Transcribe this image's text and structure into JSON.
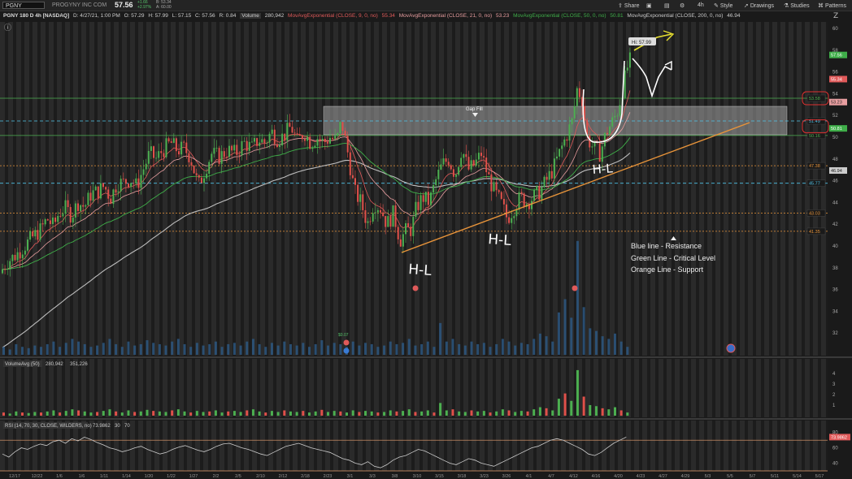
{
  "toolbar": {
    "symbol": "PGNY",
    "company": "PROGYNY INC COM",
    "price": "57.56",
    "change": "+1.66",
    "change_pct": "+2.97%",
    "bid": "B: 53.34",
    "ask": "A: 60.00",
    "buttons": {
      "share": "Share",
      "timeframe": "4h",
      "style": "Style",
      "drawings": "Drawings",
      "studies": "Studies",
      "patterns": "Patterns"
    }
  },
  "info": {
    "title": "PGNY 180 D 4h [NASDAQ]",
    "date": "D: 4/27/21, 1:00 PM",
    "open": "O: 57.29",
    "high": "H: 57.99",
    "low": "L: 57.15",
    "close": "C: 57.56",
    "rval": "R: 0.84",
    "volume_label": "Volume",
    "volume_val": "280,942",
    "ma9": "MovAvgExponential (CLOSE, 9, 0, no)",
    "ma9_val": "55.34",
    "ma21": "MovAvgExponential (CLOSE, 21, 0, no)",
    "ma21_val": "53.23",
    "ma50": "MovAvgExponential (CLOSE, 50, 0, no)",
    "ma50_val": "50.81",
    "ma200": "MovAvgExponential (CLOSE, 200, 0, no)",
    "ma200_val": "46.94"
  },
  "colors": {
    "up": "#4caf50",
    "down": "#e0504a",
    "ma9": "#e05a5a",
    "ma21": "#e89ea0",
    "ma50": "#3fae49",
    "ma200": "#bdbdbd",
    "resistance": "#4fc3e8",
    "critical": "#4caf50",
    "support": "#e8943a",
    "background": "#1a1a1a"
  },
  "annotations": {
    "gap_fill": "Gap Fill",
    "hi_label": "Hi: 57.99",
    "hl1": "H-L",
    "hl2": "H-L",
    "hl3": "H-L",
    "legend": [
      "Blue line - Resistance",
      "Green Line - Critical Level",
      "Orange Line - Support"
    ],
    "marker_label": "$0.07"
  },
  "price_tags": {
    "last": "57.56",
    "ma9": "55.34",
    "ma21": "53.23",
    "green_top": "53.58",
    "blue": "51.49",
    "green_mid": "50.16",
    "ma50": "50.81",
    "orange_top": "47.38",
    "ma200": "46.94",
    "blue_low": "45.77",
    "orange_mid": "43.03",
    "orange_low": "41.35"
  },
  "volume_panel": {
    "label": "VolumeAvg (50)",
    "val1": "280,942",
    "val2": "351,226",
    "ticks": [
      "4",
      "3",
      "2",
      "1"
    ]
  },
  "rsi_panel": {
    "label": "RSI (14, 70, 30, CLOSE, WILDERS, no)",
    "val": "73.9862",
    "ob": "30",
    "os": "70",
    "tag": "73.9862",
    "ticks": [
      "80",
      "60",
      "40"
    ]
  },
  "chart_data": {
    "type": "candlestick",
    "title": "PGNY 180 D 4h [NASDAQ]",
    "ylim": [
      30,
      60
    ],
    "yticks": [
      32,
      34,
      36,
      38,
      40,
      42,
      44,
      46,
      48,
      50,
      52,
      54,
      56,
      58,
      60
    ],
    "xticks": [
      "12/17",
      "12/22",
      "1/6",
      "1/6",
      "1/11",
      "1/14",
      "1/20",
      "1/22",
      "1/27",
      "2/2",
      "2/5",
      "2/10",
      "2/12",
      "2/18",
      "2/23",
      "3/1",
      "3/3",
      "3/8",
      "3/10",
      "3/15",
      "3/18",
      "3/23",
      "3/26",
      "4/1",
      "4/7",
      "4/12",
      "4/16",
      "4/20",
      "4/23",
      "4/27",
      "4/29",
      "5/3",
      "5/5",
      "5/7",
      "5/11",
      "5/14",
      "5/17"
    ],
    "price_path": [
      [
        0,
        37.5
      ],
      [
        8,
        38.5
      ],
      [
        20,
        39.2
      ],
      [
        30,
        40.0
      ],
      [
        40,
        40.8
      ],
      [
        50,
        41.5
      ],
      [
        58,
        42.5
      ],
      [
        66,
        41.8
      ],
      [
        72,
        43.0
      ],
      [
        80,
        43.5
      ],
      [
        88,
        42.8
      ],
      [
        96,
        44.0
      ],
      [
        104,
        43.6
      ],
      [
        112,
        44.8
      ],
      [
        120,
        45.0
      ],
      [
        128,
        45.5
      ],
      [
        136,
        44.4
      ],
      [
        144,
        45.8
      ],
      [
        152,
        45.8
      ],
      [
        160,
        46.2
      ],
      [
        168,
        45.5
      ],
      [
        176,
        47.0
      ],
      [
        184,
        48.5
      ],
      [
        192,
        48.0
      ],
      [
        200,
        48.8
      ],
      [
        210,
        49.5
      ],
      [
        218,
        48.8
      ],
      [
        226,
        49.0
      ],
      [
        234,
        48.2
      ],
      [
        244,
        45.5
      ],
      [
        252,
        47.0
      ],
      [
        260,
        48.5
      ],
      [
        270,
        48.2
      ],
      [
        280,
        48.8
      ],
      [
        290,
        48.5
      ],
      [
        300,
        49.5
      ],
      [
        310,
        49.0
      ],
      [
        318,
        49.8
      ],
      [
        326,
        49.5
      ],
      [
        334,
        50.5
      ],
      [
        342,
        49.8
      ],
      [
        350,
        50.2
      ],
      [
        358,
        51.0
      ],
      [
        366,
        49.5
      ],
      [
        374,
        50.5
      ],
      [
        382,
        49.5
      ],
      [
        390,
        50.0
      ],
      [
        398,
        49.5
      ],
      [
        406,
        50.0
      ],
      [
        414,
        49.6
      ],
      [
        420,
        51.5
      ],
      [
        428,
        48.5
      ],
      [
        436,
        45.0
      ],
      [
        444,
        44.0
      ],
      [
        452,
        42.0
      ],
      [
        460,
        44.0
      ],
      [
        468,
        43.5
      ],
      [
        476,
        42.0
      ],
      [
        484,
        43.0
      ],
      [
        492,
        40.5
      ],
      [
        500,
        41.5
      ],
      [
        506,
        41.5
      ],
      [
        512,
        43.5
      ],
      [
        520,
        44.5
      ],
      [
        528,
        44.0
      ],
      [
        536,
        46.0
      ],
      [
        544,
        47.5
      ],
      [
        552,
        48.0
      ],
      [
        560,
        46.5
      ],
      [
        568,
        49.0
      ],
      [
        576,
        47.0
      ],
      [
        584,
        47.5
      ],
      [
        592,
        48.5
      ],
      [
        600,
        46.5
      ],
      [
        608,
        45.0
      ],
      [
        616,
        44.0
      ],
      [
        624,
        42.5
      ],
      [
        632,
        43.5
      ],
      [
        640,
        44.5
      ],
      [
        648,
        44.0
      ],
      [
        656,
        44.5
      ],
      [
        664,
        45.0
      ],
      [
        672,
        46.0
      ],
      [
        680,
        47.0
      ],
      [
        688,
        48.5
      ],
      [
        696,
        50.0
      ],
      [
        704,
        51.5
      ],
      [
        710,
        54.5
      ],
      [
        716,
        53.5
      ],
      [
        722,
        50.0
      ],
      [
        730,
        49.0
      ],
      [
        738,
        48.5
      ],
      [
        746,
        50.5
      ],
      [
        754,
        51.5
      ],
      [
        760,
        52.5
      ],
      [
        766,
        54.5
      ],
      [
        772,
        56.5
      ],
      [
        778,
        57.56
      ]
    ],
    "volume_max": 4.6,
    "volume": [
      0.3,
      0.2,
      0.4,
      0.3,
      0.25,
      0.35,
      0.3,
      0.4,
      0.5,
      0.3,
      0.45,
      0.6,
      0.5,
      0.4,
      0.3,
      0.35,
      0.45,
      0.6,
      0.4,
      0.3,
      0.5,
      0.35,
      0.4,
      0.55,
      0.45,
      0.4,
      0.35,
      0.5,
      0.6,
      0.4,
      0.3,
      0.45,
      0.35,
      0.4,
      0.5,
      0.3,
      0.4,
      0.45,
      0.35,
      0.5,
      0.6,
      0.4,
      0.3,
      0.45,
      0.35,
      0.5,
      0.4,
      0.35,
      0.45,
      0.3,
      0.4,
      0.55,
      0.35,
      0.45,
      0.4,
      0.3,
      0.5,
      0.35,
      0.45,
      0.4,
      0.3,
      0.35,
      0.5,
      0.4,
      0.45,
      0.6,
      0.35,
      0.4,
      0.5,
      0.3,
      1.2,
      0.5,
      0.6,
      0.4,
      0.35,
      0.5,
      0.4,
      0.45,
      0.3,
      0.4,
      0.6,
      0.5,
      0.35,
      0.45,
      0.4,
      0.6,
      0.8,
      0.7,
      0.5,
      1.6,
      2.1,
      1.4,
      4.3,
      1.8,
      1.0,
      0.9,
      0.7,
      0.6,
      0.8,
      0.5,
      0.3
    ],
    "rsi": [
      52,
      48,
      55,
      60,
      58,
      62,
      65,
      63,
      68,
      70,
      66,
      72,
      69,
      74,
      71,
      67,
      64,
      60,
      58,
      55,
      57,
      60,
      62,
      58,
      55,
      52,
      54,
      58,
      61,
      63,
      60,
      57,
      55,
      58,
      62,
      65,
      66,
      63,
      60,
      58,
      55,
      52,
      50,
      54,
      58,
      62,
      64,
      66,
      63,
      60,
      58,
      56,
      54,
      50,
      46,
      44,
      40,
      38,
      42,
      36,
      34,
      38,
      44,
      48,
      50,
      54,
      58,
      56,
      52,
      48,
      44,
      40,
      38,
      42,
      46,
      44,
      40,
      38,
      36,
      40,
      44,
      48,
      52,
      56,
      60,
      62,
      66,
      70,
      72,
      70,
      66,
      62,
      58,
      52,
      50,
      54,
      60,
      66,
      70,
      73.99
    ],
    "rsi_ylim": [
      30,
      85
    ]
  }
}
